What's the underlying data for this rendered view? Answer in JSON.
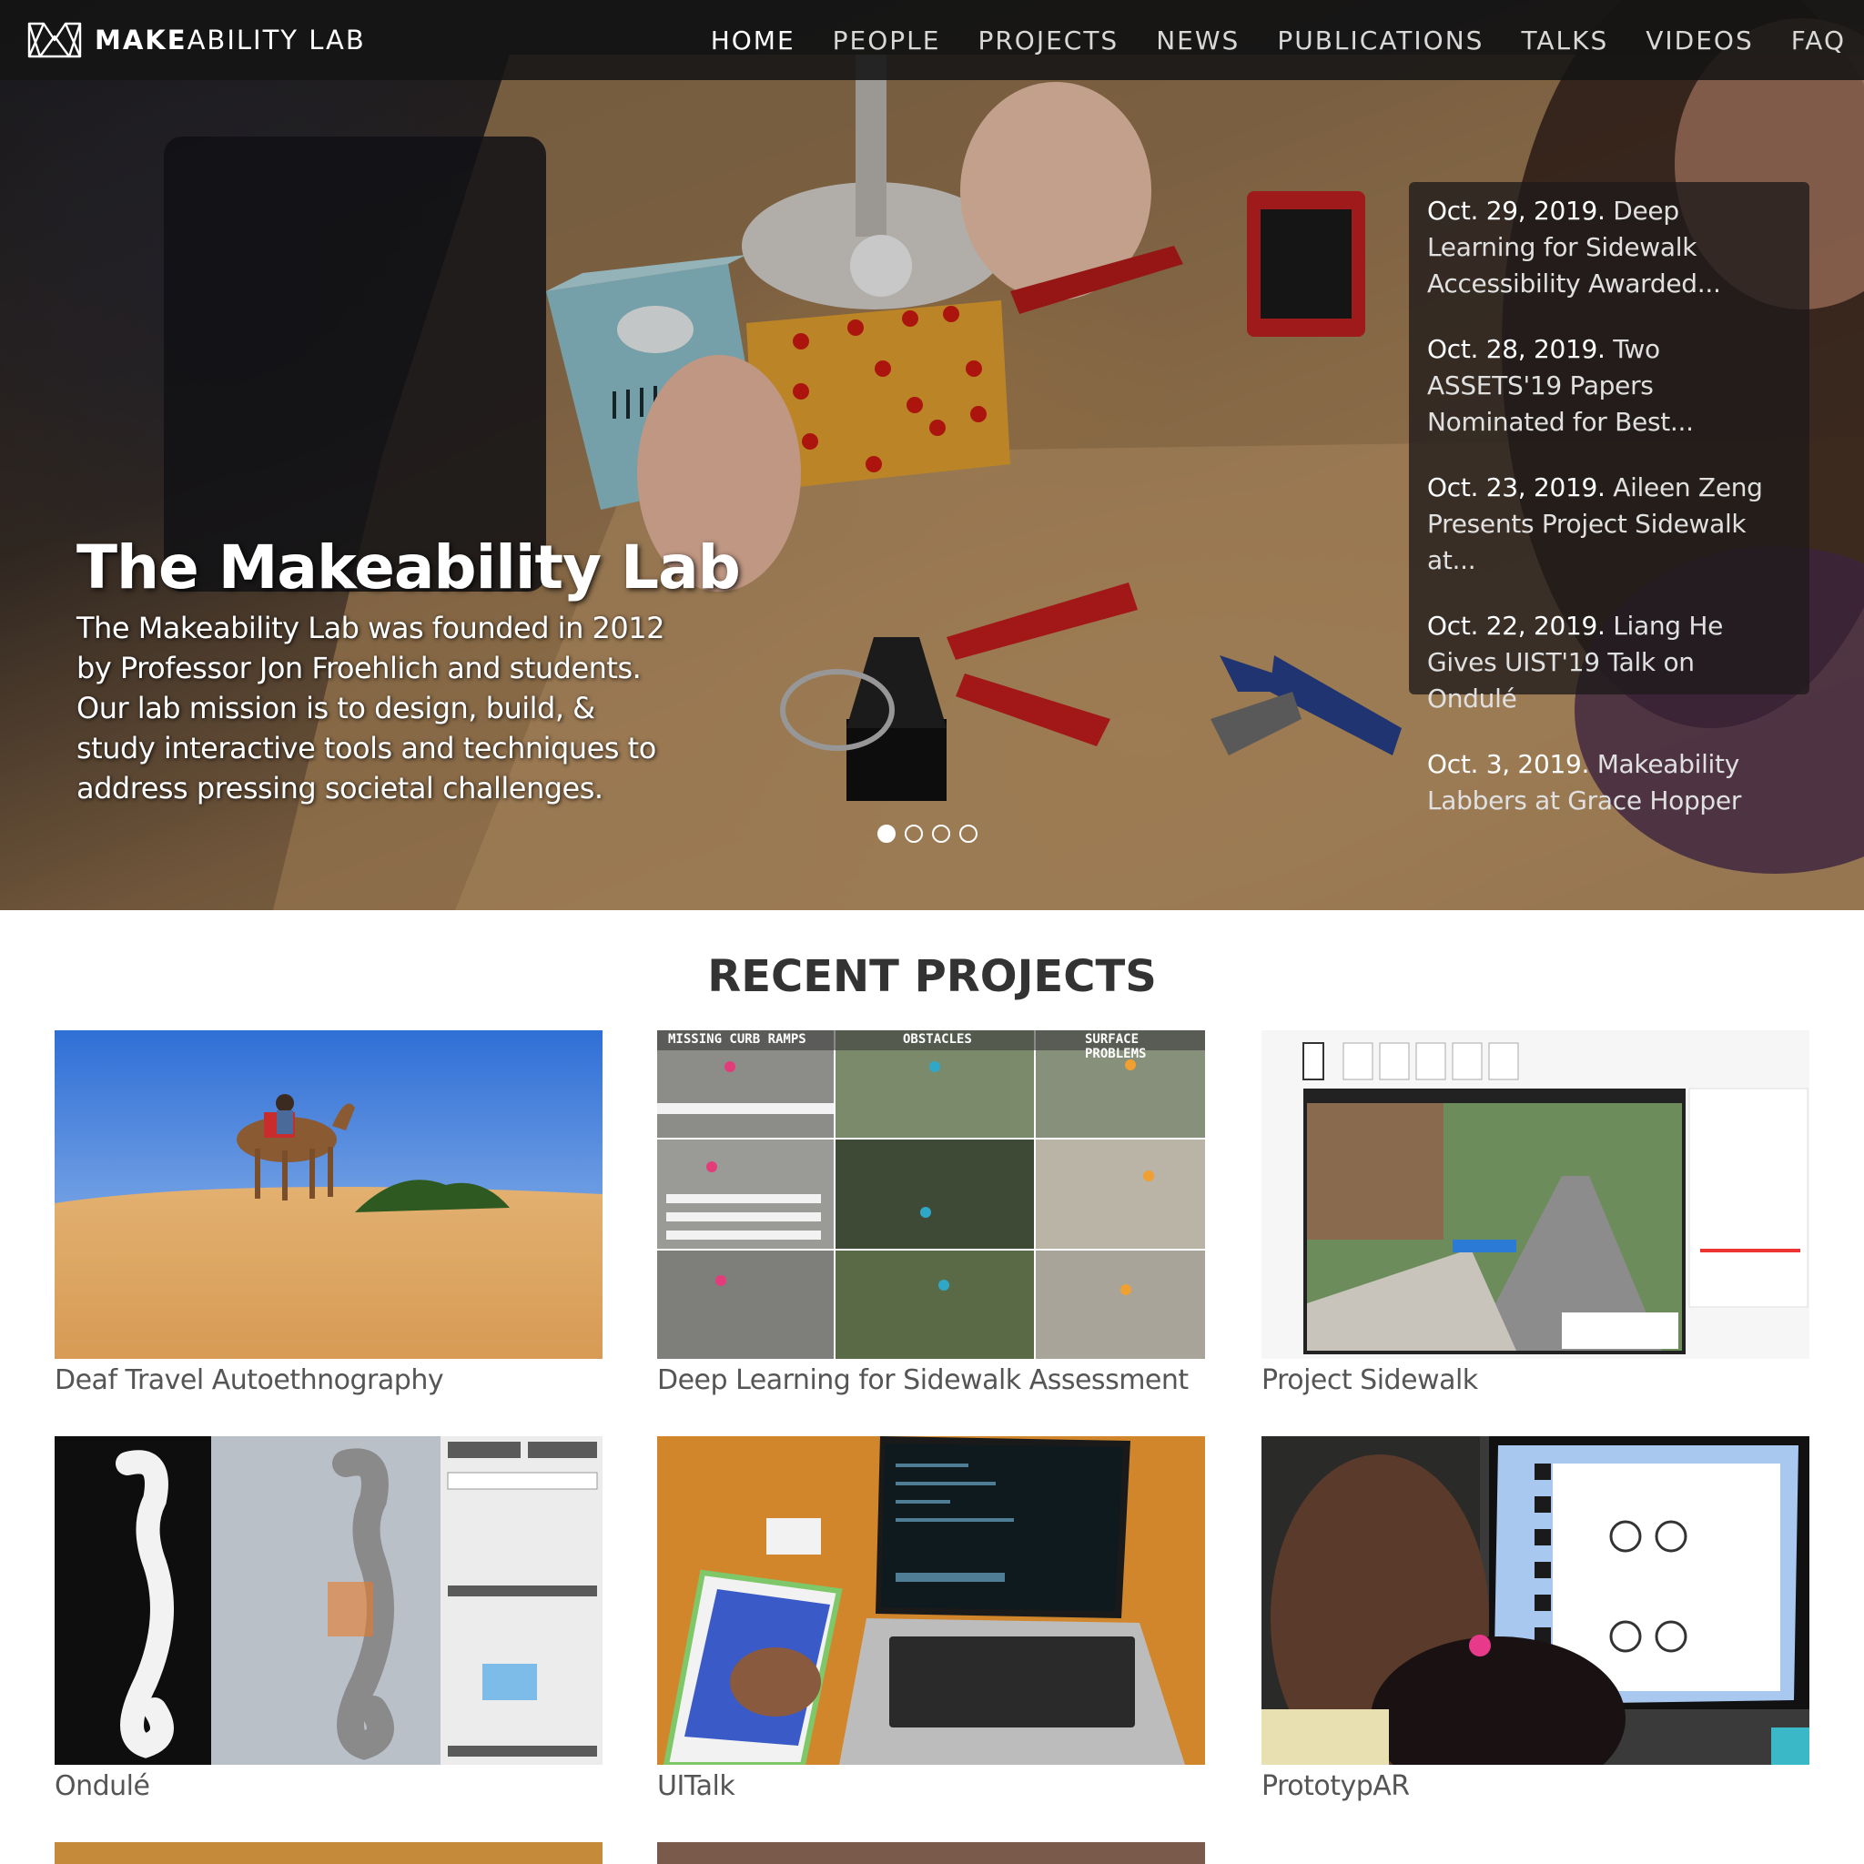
{
  "brand": {
    "name_bold": "MAKE",
    "name_rest": "ABILITY LAB"
  },
  "nav": [
    {
      "label": "HOME",
      "active": true
    },
    {
      "label": "PEOPLE"
    },
    {
      "label": "PROJECTS"
    },
    {
      "label": "NEWS"
    },
    {
      "label": "PUBLICATIONS"
    },
    {
      "label": "TALKS"
    },
    {
      "label": "VIDEOS"
    },
    {
      "label": "FAQ"
    }
  ],
  "hero": {
    "title": "The Makeability Lab",
    "description": "The Makeability Lab was founded in 2012 by Professor Jon Froehlich and students. Our lab mission is to design, build, & study interactive tools and techniques to address pressing societal challenges.",
    "carousel_slides": 4,
    "carousel_active": 0
  },
  "news": [
    {
      "date": "Oct. 29, 2019.",
      "text": "Deep Learning for Sidewalk Accessibility Awarded..."
    },
    {
      "date": "Oct. 28, 2019.",
      "text": "Two ASSETS'19 Papers Nominated for Best..."
    },
    {
      "date": "Oct. 23, 2019.",
      "text": "Aileen Zeng Presents Project Sidewalk at..."
    },
    {
      "date": "Oct. 22, 2019.",
      "text": "Liang He Gives UIST'19 Talk on Ondulé"
    },
    {
      "date": "Oct. 3, 2019.",
      "text": "Makeability Labbers at Grace Hopper"
    }
  ],
  "recent_projects": {
    "title": "RECENT PROJECTS",
    "items": [
      {
        "name": "Deaf Travel Autoethnography"
      },
      {
        "name": "Deep Learning for Sidewalk Assessment",
        "panel_labels": [
          "MISSING CURB RAMPS",
          "OBSTACLES",
          "SURFACE PROBLEMS"
        ]
      },
      {
        "name": "Project Sidewalk"
      },
      {
        "name": "Ondulé"
      },
      {
        "name": "UITalk"
      },
      {
        "name": "PrototypAR"
      }
    ]
  },
  "colors": {
    "nav_bg": "#141414",
    "accent_white": "#ffffff",
    "text_gray": "#555555"
  }
}
